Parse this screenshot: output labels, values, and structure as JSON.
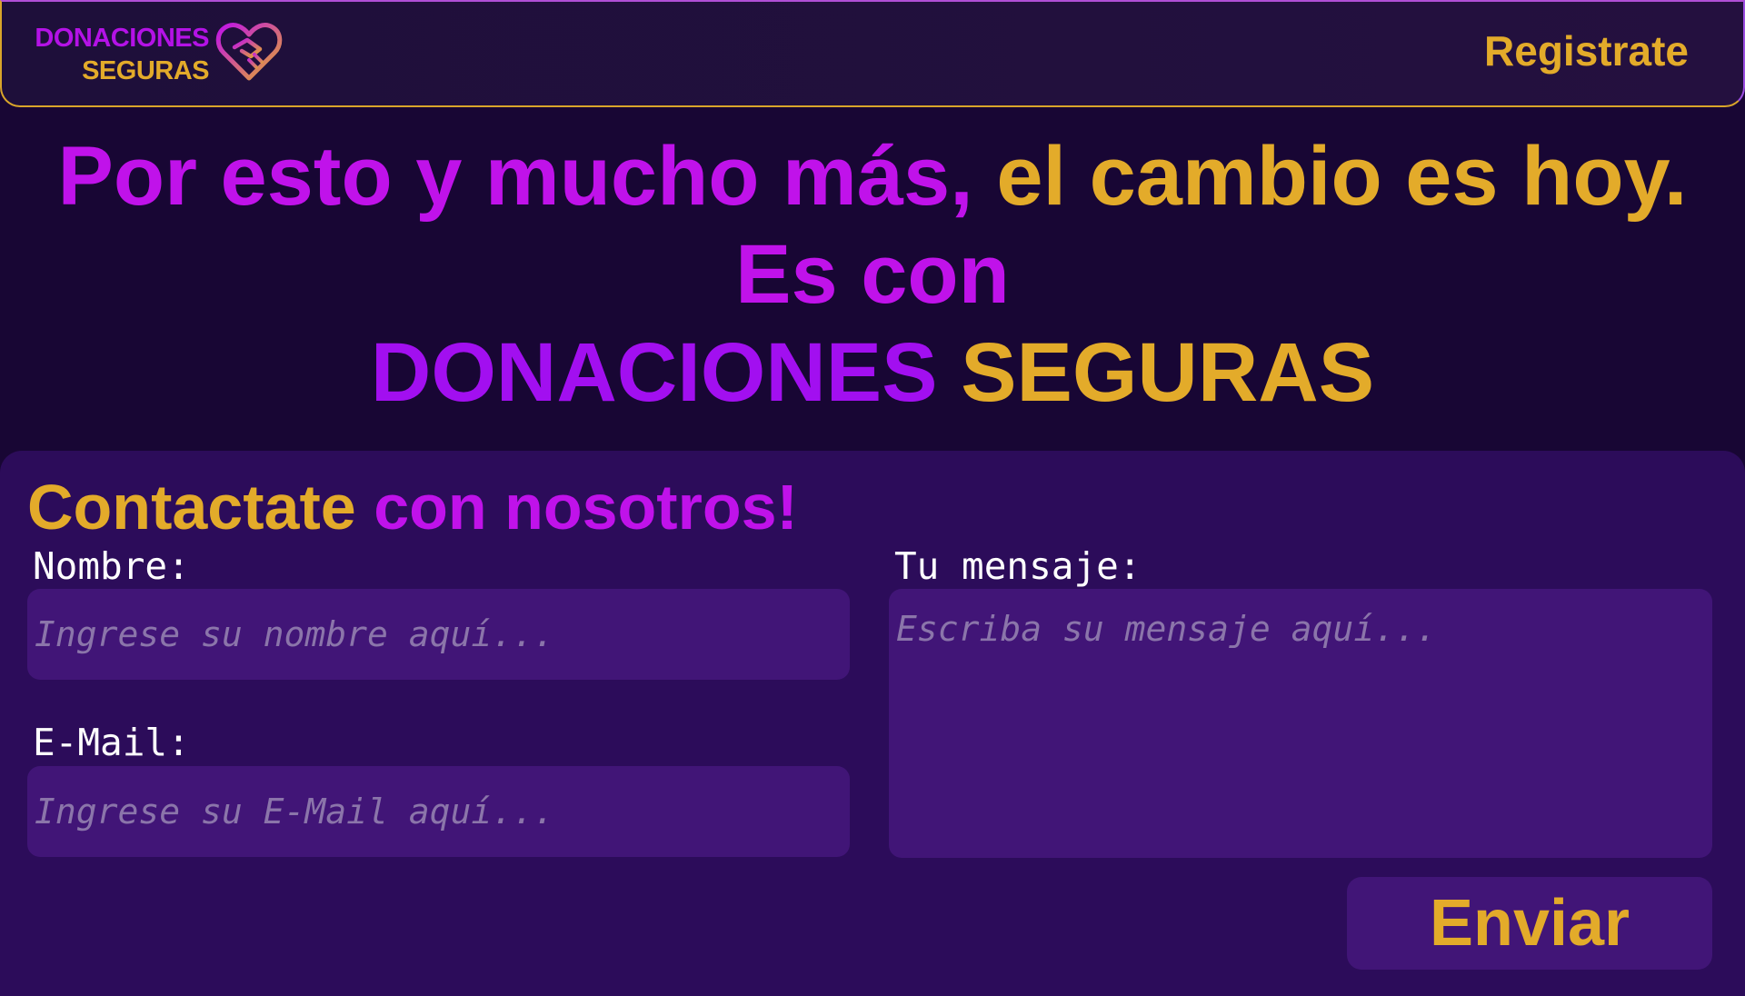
{
  "header": {
    "logo": {
      "line1": "DONACIONES",
      "line2": "SEGURAS",
      "icon": "heart-handshake-icon"
    },
    "register_label": "Registrate"
  },
  "hero": {
    "line1_part1": "Por esto y mucho más,",
    "line1_part2": "el cambio es hoy.",
    "line2": "Es con",
    "line3_part1": "DONACIONES",
    "line3_part2": "SEGURAS"
  },
  "contact": {
    "title_part1": "Contactate",
    "title_part2": "con nosotros!",
    "name_label": "Nombre:",
    "name_placeholder": "Ingrese su nombre aquí...",
    "email_label": "E-Mail:",
    "email_placeholder": "Ingrese su E-Mail aquí...",
    "message_label": "Tu mensaje:",
    "message_placeholder": "Escriba su mensaje aquí...",
    "send_label": "Enviar"
  },
  "colors": {
    "background": "#180634",
    "panel": "#2c0c5a",
    "field": "#411577",
    "gold": "#e3ab2a",
    "pink": "#c012ea",
    "violet": "#a20ff0"
  }
}
